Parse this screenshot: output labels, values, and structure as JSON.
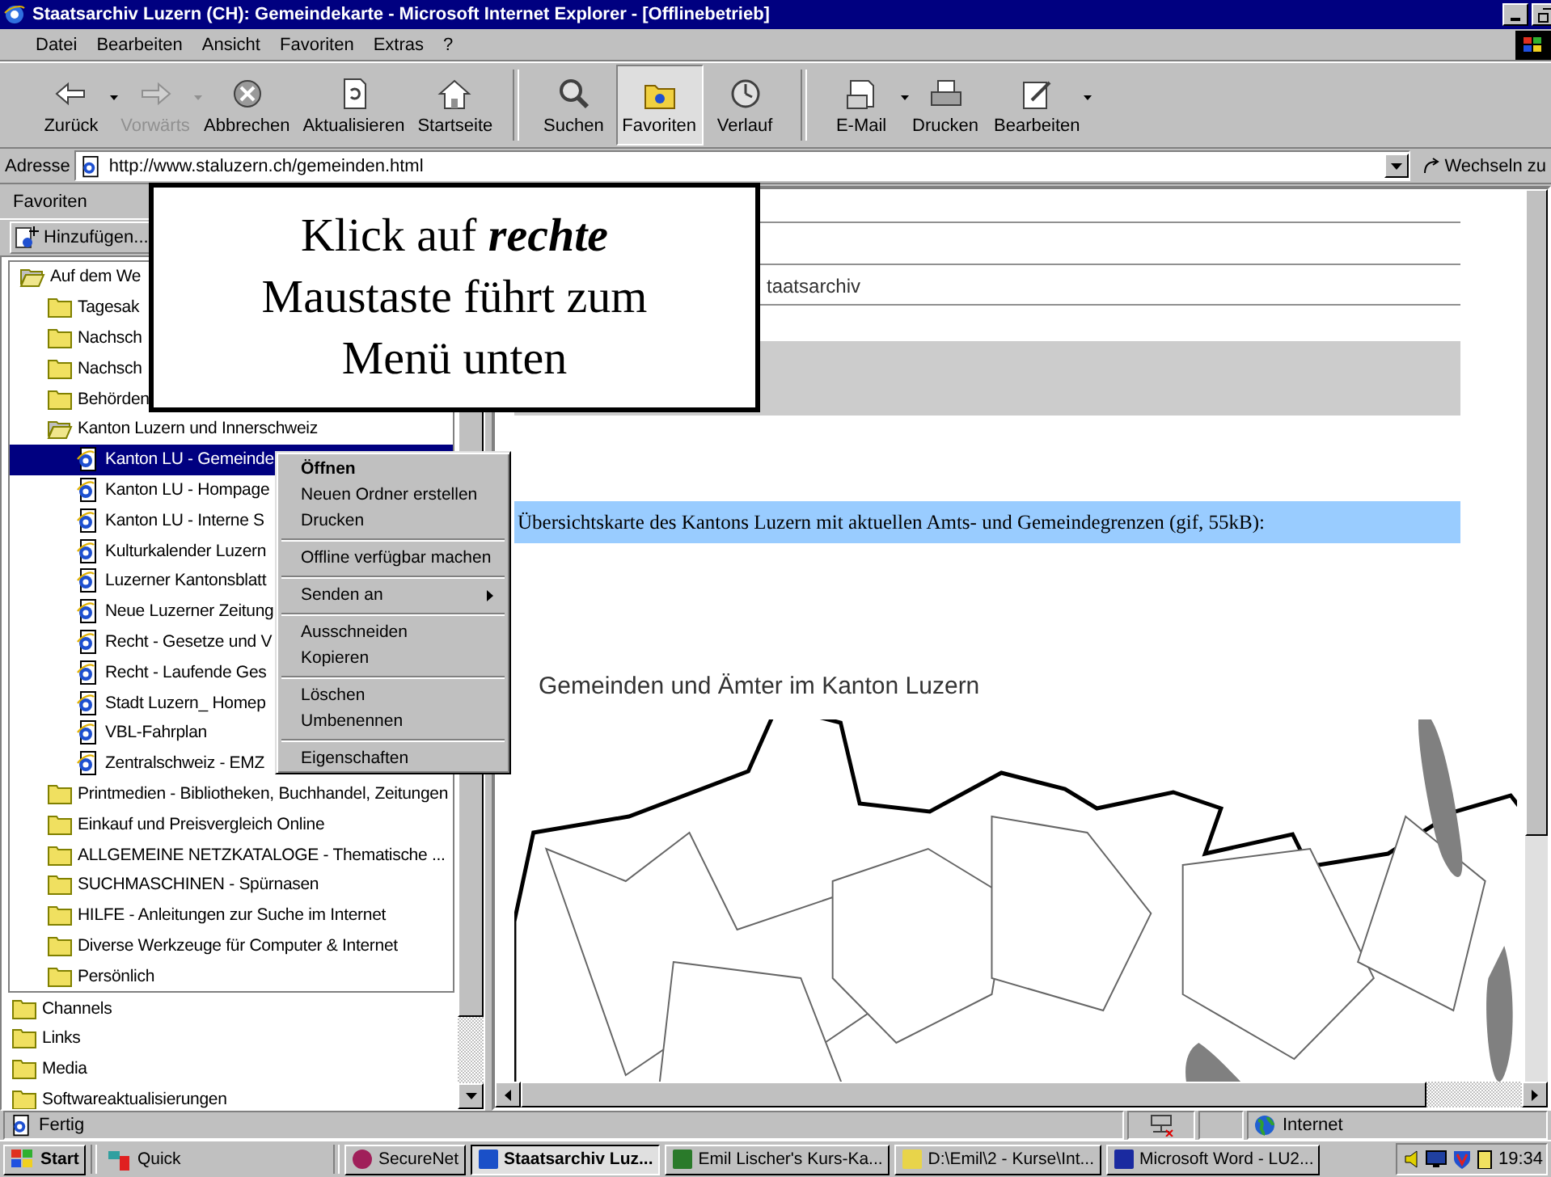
{
  "window": {
    "title": "Staatsarchiv Luzern (CH): Gemeindekarte - Microsoft Internet Explorer - [Offlinebetrieb]"
  },
  "menu": [
    "Datei",
    "Bearbeiten",
    "Ansicht",
    "Favoriten",
    "Extras",
    "?"
  ],
  "toolbar": [
    [
      {
        "label": "Zurück",
        "kind": "back",
        "disabled": false,
        "selected": false,
        "dropdown": true
      },
      {
        "label": "Vorwärts",
        "kind": "forward",
        "disabled": true,
        "selected": false,
        "dropdown": true
      },
      {
        "label": "Abbrechen",
        "kind": "stop",
        "disabled": false,
        "selected": false,
        "dropdown": false
      },
      {
        "label": "Aktualisieren",
        "kind": "refresh",
        "disabled": false,
        "selected": false,
        "dropdown": false
      },
      {
        "label": "Startseite",
        "kind": "home",
        "disabled": false,
        "selected": false,
        "dropdown": false
      }
    ],
    [
      {
        "label": "Suchen",
        "kind": "search",
        "disabled": false,
        "selected": false,
        "dropdown": false
      },
      {
        "label": "Favoriten",
        "kind": "favorites",
        "disabled": false,
        "selected": true,
        "dropdown": false
      },
      {
        "label": "Verlauf",
        "kind": "history",
        "disabled": false,
        "selected": false,
        "dropdown": false
      }
    ],
    [
      {
        "label": "E-Mail",
        "kind": "mail",
        "disabled": false,
        "selected": false,
        "dropdown": true
      },
      {
        "label": "Drucken",
        "kind": "print",
        "disabled": false,
        "selected": false,
        "dropdown": false
      },
      {
        "label": "Bearbeiten",
        "kind": "edit",
        "disabled": false,
        "selected": false,
        "dropdown": true
      }
    ]
  ],
  "address": {
    "label": "Adresse",
    "value": "http://www.staluzern.ch/gemeinden.html",
    "go": "Wechseln zu"
  },
  "sidebar": {
    "title": "Favoriten",
    "add": "Hinzufügen...",
    "tree": [
      {
        "label": "Auf dem We",
        "kind": "folder",
        "expanded": true,
        "selected": false,
        "children": [
          {
            "label": "Tagesak",
            "kind": "folder",
            "expanded": false,
            "selected": false
          },
          {
            "label": "Nachsch",
            "kind": "folder",
            "expanded": false,
            "selected": false
          },
          {
            "label": "Nachsch",
            "kind": "folder",
            "expanded": false,
            "selected": false
          },
          {
            "label": "Behörden",
            "kind": "folder",
            "expanded": false,
            "selected": false
          },
          {
            "label": "Kanton Luzern und Innerschweiz",
            "kind": "folder",
            "expanded": true,
            "selected": false,
            "children": [
              {
                "label": "Kanton LU - Gemeinde",
                "kind": "link",
                "selected": true
              },
              {
                "label": "Kanton LU - Hompage",
                "kind": "link",
                "selected": false
              },
              {
                "label": "Kanton LU - Interne S",
                "kind": "link",
                "selected": false
              },
              {
                "label": "Kulturkalender Luzern",
                "kind": "link",
                "selected": false
              },
              {
                "label": "Luzerner Kantonsblatt",
                "kind": "link",
                "selected": false
              },
              {
                "label": "Neue Luzerner Zeitung",
                "kind": "link",
                "selected": false
              },
              {
                "label": "Recht - Gesetze und V",
                "kind": "link",
                "selected": false
              },
              {
                "label": "Recht - Laufende Ges",
                "kind": "link",
                "selected": false
              },
              {
                "label": "Stadt Luzern_ Homep",
                "kind": "link",
                "selected": false
              },
              {
                "label": "VBL-Fahrplan",
                "kind": "link",
                "selected": false
              },
              {
                "label": "Zentralschweiz - EMZ",
                "kind": "link",
                "selected": false
              }
            ]
          },
          {
            "label": "Printmedien - Bibliotheken, Buchhandel, Zeitungen",
            "kind": "folder",
            "expanded": false,
            "selected": false
          },
          {
            "label": "Einkauf und Preisvergleich Online",
            "kind": "folder",
            "expanded": false,
            "selected": false
          },
          {
            "label": "ALLGEMEINE NETZKATALOGE - Thematische ...",
            "kind": "folder",
            "expanded": false,
            "selected": false
          },
          {
            "label": "SUCHMASCHINEN - Spürnasen",
            "kind": "folder",
            "expanded": false,
            "selected": false
          },
          {
            "label": "HILFE - Anleitungen zur Suche im Internet",
            "kind": "folder",
            "expanded": false,
            "selected": false
          },
          {
            "label": "Diverse Werkzeuge für Computer & Internet",
            "kind": "folder",
            "expanded": false,
            "selected": false
          },
          {
            "label": "Persönlich",
            "kind": "folder",
            "expanded": false,
            "selected": false
          }
        ]
      },
      {
        "label": "Channels",
        "kind": "folder",
        "expanded": false,
        "selected": false
      },
      {
        "label": "Links",
        "kind": "folder",
        "expanded": false,
        "selected": false
      },
      {
        "label": "Media",
        "kind": "folder",
        "expanded": false,
        "selected": false
      },
      {
        "label": "Softwareaktualisierungen",
        "kind": "folder",
        "expanded": false,
        "selected": false
      }
    ]
  },
  "page": {
    "heading": "taatsarchiv",
    "map_intro": "Übersichtskarte des Kantons Luzern mit aktuellen Amts- und Gemeindegrenzen (gif, 55kB):",
    "map_title": "Gemeinden und Ämter im Kanton Luzern"
  },
  "callout": {
    "lines": [
      "Klick auf *rechte*",
      "Maustaste führt zum",
      "Menü unten"
    ]
  },
  "context_menu": [
    [
      {
        "label": "Öffnen",
        "default": true,
        "submenu": false
      },
      {
        "label": "Neuen Ordner erstellen",
        "default": false,
        "submenu": false
      },
      {
        "label": "Drucken",
        "default": false,
        "submenu": false
      }
    ],
    [
      {
        "label": "Offline verfügbar machen",
        "default": false,
        "submenu": false
      }
    ],
    [
      {
        "label": "Senden an",
        "default": false,
        "submenu": true
      }
    ],
    [
      {
        "label": "Ausschneiden",
        "default": false,
        "submenu": false
      },
      {
        "label": "Kopieren",
        "default": false,
        "submenu": false
      }
    ],
    [
      {
        "label": "Löschen",
        "default": false,
        "submenu": false
      },
      {
        "label": "Umbenennen",
        "default": false,
        "submenu": false
      }
    ],
    [
      {
        "label": "Eigenschaften",
        "default": false,
        "submenu": false
      }
    ]
  ],
  "status_bar": {
    "text": "Fertig",
    "zone": "Internet"
  },
  "taskbar": {
    "start": "Start",
    "quick": "Quick",
    "tasks": [
      {
        "label": "SecureNet",
        "kind": "securenet",
        "selected": false
      },
      {
        "label": "Staatsarchiv Luz...",
        "kind": "browser",
        "selected": true
      },
      {
        "label": "Emil Lischer's Kurs-Ka...",
        "kind": "app",
        "selected": false
      },
      {
        "label": "D:\\Emil\\2 - Kurse\\Int...",
        "kind": "folder",
        "selected": false
      },
      {
        "label": "Microsoft Word - LU2...",
        "kind": "word",
        "selected": false
      }
    ],
    "clock": "19:34"
  }
}
